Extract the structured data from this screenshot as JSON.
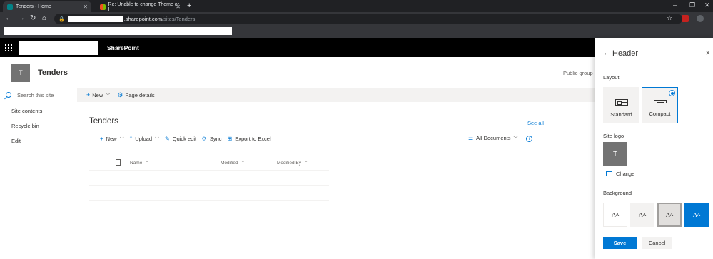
{
  "browser": {
    "tabs": [
      {
        "title": "Tenders - Home",
        "favicon_color": "#038387"
      },
      {
        "title": "Re: Unable to change Theme or H",
        "favicon_color": "#f25022"
      }
    ],
    "new_tab_icon": "plus-icon",
    "url_host": ".sharepoint.com",
    "url_path": "/sites/Tenders"
  },
  "suitebar": {
    "app_name": "SharePoint",
    "waffle_icon": "app-launcher-icon"
  },
  "site": {
    "logo_letter": "T",
    "title": "Tenders",
    "visibility": "Public group",
    "logo_color": "#737373"
  },
  "leftnav": {
    "search_placeholder": "Search this site",
    "items": [
      "Site contents",
      "Recycle bin",
      "Edit"
    ]
  },
  "commandbar": {
    "new_label": "New",
    "page_details_label": "Page details"
  },
  "library": {
    "title": "Tenders",
    "see_all": "See all",
    "commands": {
      "new": "New",
      "upload": "Upload",
      "quick_edit": "Quick edit",
      "sync": "Sync",
      "export": "Export to Excel"
    },
    "view": "All Documents",
    "columns": {
      "name": "Name",
      "modified": "Modified",
      "modified_by": "Modified By"
    }
  },
  "panel": {
    "title": "Header",
    "layout_label": "Layout",
    "layout_options": {
      "standard": "Standard",
      "compact": "Compact"
    },
    "selected_layout": "Compact",
    "site_logo_label": "Site logo",
    "logo_letter": "T",
    "change_label": "Change",
    "background_label": "Background",
    "swatch_text": "A",
    "save": "Save",
    "cancel": "Cancel",
    "accent_color": "#0078d4"
  }
}
